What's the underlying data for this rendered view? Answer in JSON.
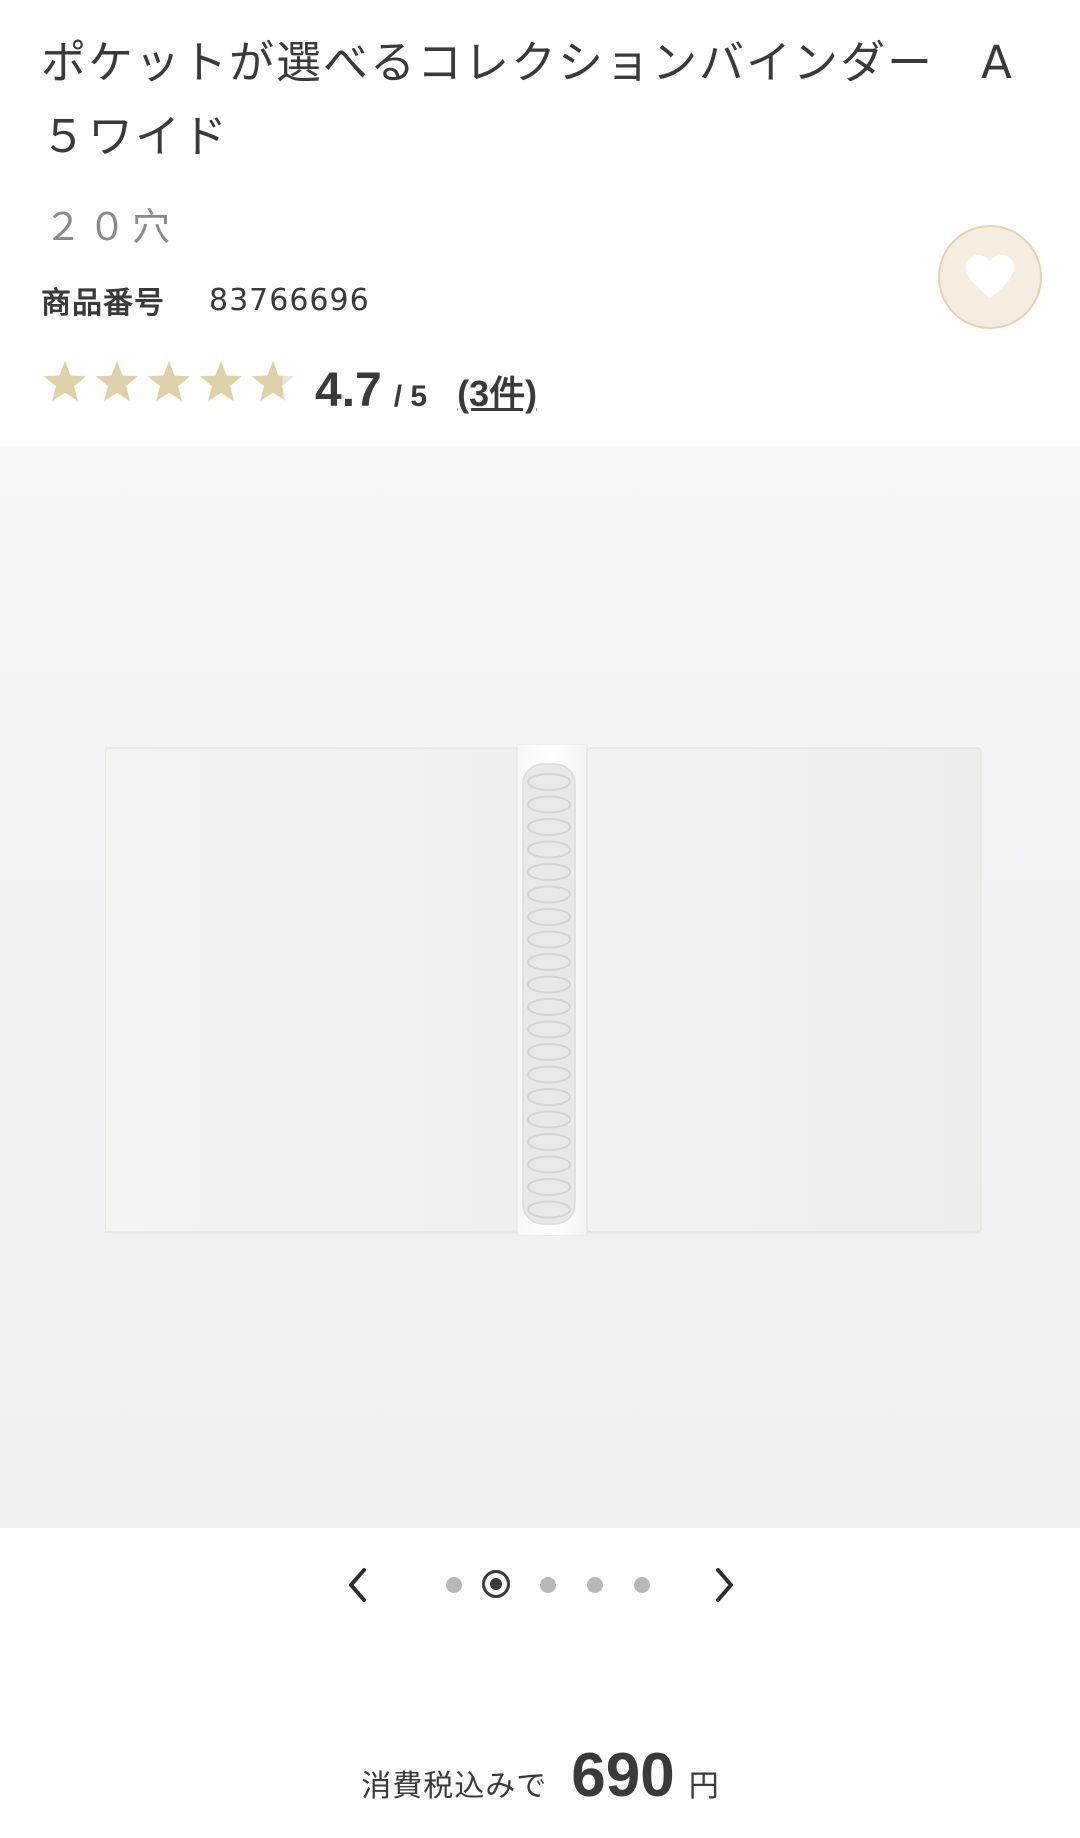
{
  "product": {
    "title": "ポケットが選べるコレクションバインダー　A５ワイド",
    "variant": "２０穴",
    "product_no_label": "商品番号",
    "product_no": "83766696"
  },
  "rating": {
    "stars": 4.7,
    "score": "4.7",
    "outof": "/ 5",
    "count": "(3件)"
  },
  "favorite": {
    "icon": "heart-icon"
  },
  "carousel": {
    "prev_icon": "chevron-left-icon",
    "next_icon": "chevron-right-icon",
    "dots": 5,
    "active_index": 1
  },
  "price": {
    "prefix": "消費税込みで",
    "amount": "690",
    "unit": "円"
  },
  "colors": {
    "star": "#dfd0a8",
    "accent_bg": "#f4ede0",
    "text": "#3a3a3a"
  }
}
